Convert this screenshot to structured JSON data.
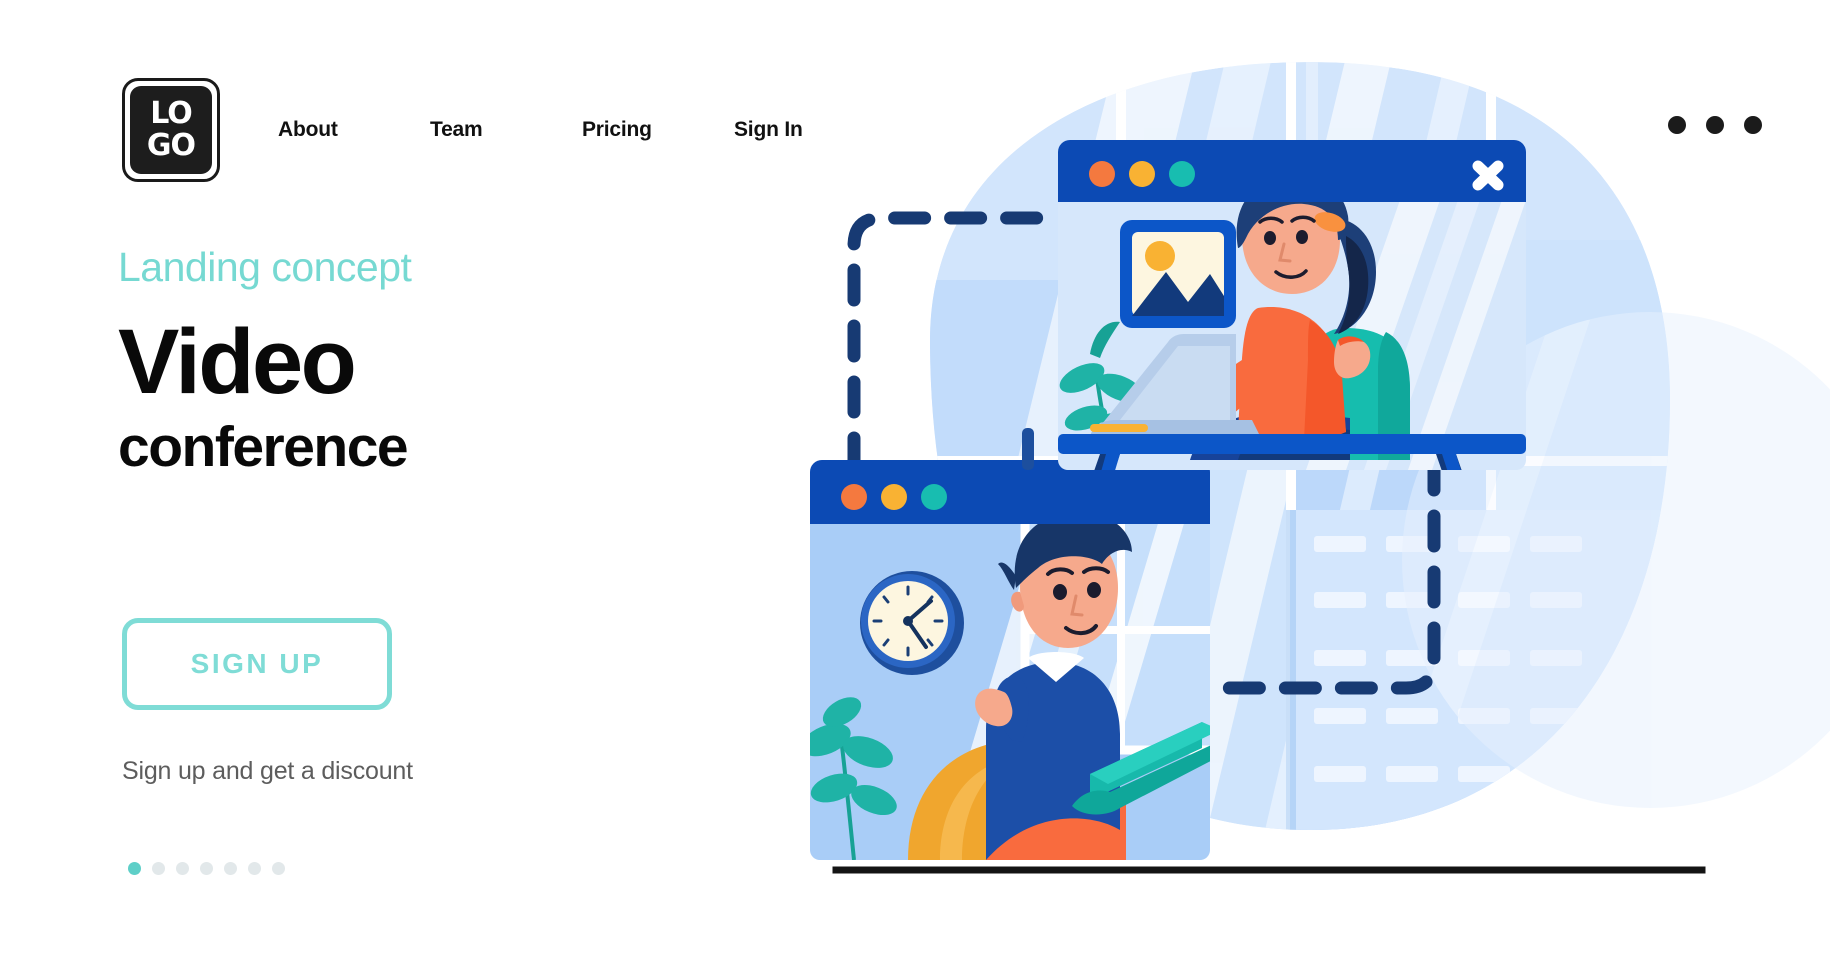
{
  "header": {
    "logo": {
      "line1": "LO",
      "line2": "GO",
      "name": "logo"
    },
    "nav": [
      {
        "label": "About"
      },
      {
        "label": "Team"
      },
      {
        "label": "Pricing"
      },
      {
        "label": "Sign In"
      }
    ],
    "menu_icon": "kebab-menu-icon"
  },
  "hero": {
    "eyebrow": "Landing concept",
    "title_line1": "Video",
    "title_line2": "conference",
    "cta_label": "SIGN UP",
    "subtext": "Sign up and get a discount",
    "carousel": {
      "total": 7,
      "active_index": 0
    }
  },
  "colors": {
    "accent_teal": "#7fdcd6",
    "eyebrow_teal": "#76d9d2",
    "text_dark": "#090909",
    "text_muted": "#5d5d5d",
    "window_header_blue": "#0c4ab4",
    "window_body_blue": "#d6e7fb",
    "window_body_blue2": "#a9cdf7",
    "navy": "#123a7c",
    "dot_red": "#f4793f",
    "dot_yellow": "#f9b233",
    "dot_teal": "#18bdb0",
    "orange": "#f96b3e",
    "skin": "#f6a98c",
    "bg_blob": "#cfe3fb",
    "black_rule": "#141414"
  },
  "illustration": {
    "name": "video-conference-illustration",
    "window_top": {
      "name": "video-window-top",
      "traffic_lights": [
        "red",
        "yellow",
        "teal"
      ],
      "close_icon": "close-x-icon",
      "image_placeholder_icon": "image-placeholder-icon",
      "person": "woman-waving-at-laptop"
    },
    "window_bottom": {
      "name": "video-window-bottom",
      "traffic_lights": [
        "red",
        "yellow",
        "teal"
      ],
      "clock_icon": "wall-clock-icon",
      "person": "man-waving-with-laptop"
    },
    "connector": "dashed-connector-line",
    "baseline": "ground-rule"
  }
}
